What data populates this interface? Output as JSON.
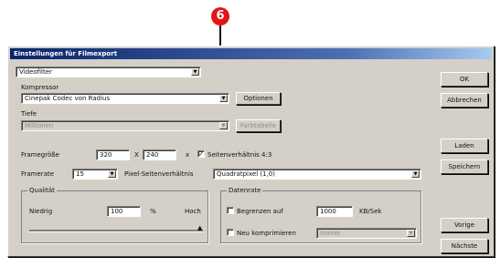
{
  "callout": "6",
  "dialog": {
    "title": "Einstellungen für Filmexport",
    "format": {
      "value": "Videofilter"
    },
    "compressor": {
      "label": "Kompressor",
      "value": "Cinepak Codec von Radius",
      "options_button": "Optionen"
    },
    "depth": {
      "label": "Tiefe",
      "value": "Millionen",
      "colors_button": "Farbtabelle"
    },
    "frame_size": {
      "label": "Framegröße",
      "width": "320",
      "separator": "X",
      "height": "240",
      "unit": "x",
      "aspect_checkbox_label": "Seitenverhältnis 4:3",
      "aspect_checked": true
    },
    "frame_rate": {
      "label": "Framerate",
      "value": "15",
      "pixel_aspect_label": "Pixel-Seitenverhältnis",
      "pixel_aspect_value": "Quadratpixel (1,0)"
    },
    "quality": {
      "label": "Qualität",
      "low": "Niedrig",
      "value": "100",
      "unit": "%",
      "high": "Hoch",
      "level": 1.0
    },
    "data_rate": {
      "label": "Datenrate",
      "limit_label": "Begrenzen auf",
      "limit_value": "1000",
      "limit_unit": "KB/Sek",
      "limit_checked": false,
      "recompress_label": "Neu komprimieren",
      "recompress_value": "Immer",
      "recompress_checked": false
    },
    "buttons": {
      "ok": "OK",
      "cancel": "Abbrechen",
      "load": "Laden",
      "save": "Speichern",
      "prev": "Vorige",
      "next": "Nächste"
    }
  }
}
